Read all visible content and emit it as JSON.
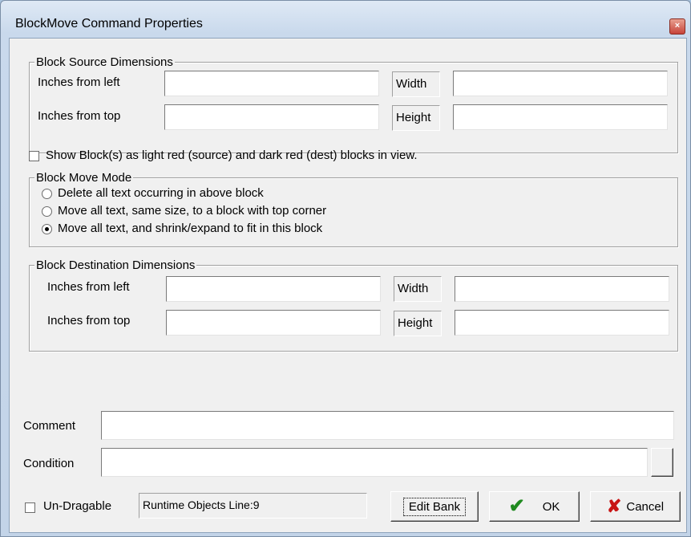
{
  "window": {
    "title": "BlockMove Command Properties",
    "close_glyph": "×"
  },
  "source_group": {
    "title": "Block Source Dimensions",
    "left_label": "Inches from left",
    "top_label": "Inches from top",
    "width_label": "Width",
    "height_label": "Height",
    "left_value": "",
    "top_value": "",
    "width_value": "",
    "height_value": ""
  },
  "show_blocks": {
    "label": "Show Block(s) as light red (source) and dark red (dest) blocks in view.",
    "checked": false
  },
  "mode_group": {
    "title": "Block Move Mode",
    "options": [
      {
        "label": "Delete all text occurring in above block",
        "checked": false
      },
      {
        "label": "Move all text, same size, to a block with top corner",
        "checked": false
      },
      {
        "label": "Move all text,  and shrink/expand to fit in this block",
        "checked": true
      }
    ]
  },
  "dest_group": {
    "title": "Block Destination Dimensions",
    "left_label": "Inches from left",
    "top_label": "Inches from top",
    "width_label": "Width",
    "height_label": "Height",
    "left_value": "",
    "top_value": "",
    "width_value": "",
    "height_value": ""
  },
  "comment": {
    "label": "Comment",
    "value": ""
  },
  "condition": {
    "label": "Condition",
    "value": ""
  },
  "footer": {
    "undragable_label": "Un-Dragable",
    "undragable_checked": false,
    "status_text": "Runtime Objects  Line:9",
    "edit_bank_label": "Edit Bank",
    "ok_label": "OK",
    "cancel_label": "Cancel",
    "ok_icon": "checkmark-icon",
    "cancel_icon": "x-icon"
  }
}
